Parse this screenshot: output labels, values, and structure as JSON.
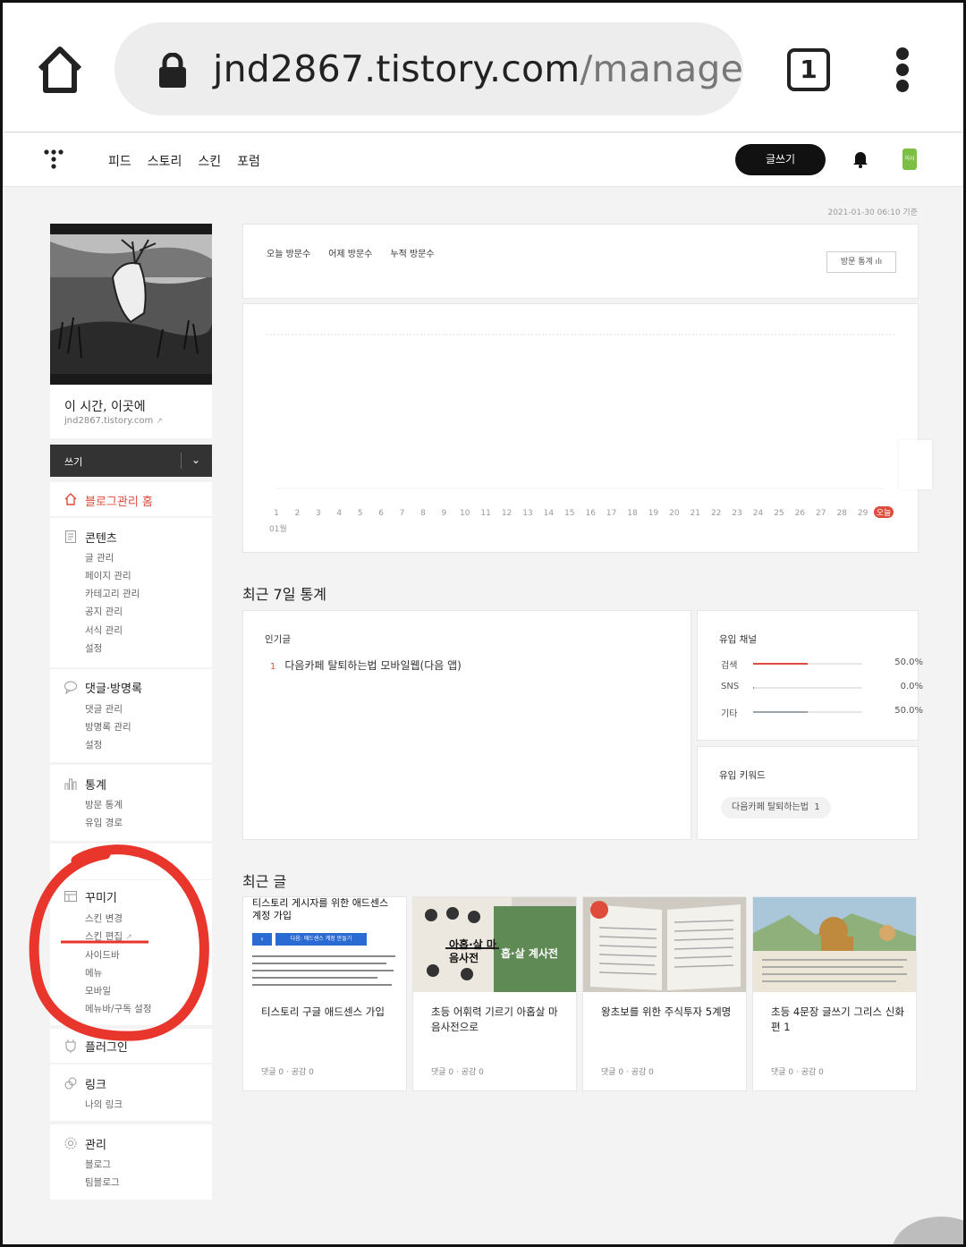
{
  "browser": {
    "url_host": "jnd2867.tistory.com",
    "url_path": "/manage",
    "tab_count": "1"
  },
  "topnav": {
    "links": [
      "피드",
      "스토리",
      "스킨",
      "포럼"
    ],
    "write_label": "글쓰기",
    "avatar_text": "이시간"
  },
  "timestamp": "2021-01-30 06:10 기준",
  "profile": {
    "blog_name": "이 시간, 이곳에",
    "blog_url": "jnd2867.tistory.com"
  },
  "write_bar": {
    "label": "쓰기"
  },
  "sidebar": {
    "home": "블로그관리 홈",
    "content": {
      "title": "콘텐츠",
      "items": [
        "글 관리",
        "페이지 관리",
        "카테고리 관리",
        "공지 관리",
        "서식 관리",
        "설정"
      ]
    },
    "comments": {
      "title": "댓글·방명록",
      "items": [
        "댓글 관리",
        "방명록 관리",
        "설정"
      ]
    },
    "stats": {
      "title": "통계",
      "items": [
        "방문 통계",
        "유입 경로"
      ]
    },
    "decorate": {
      "title": "꾸미기",
      "items": [
        "스킨 변경",
        "스킨 편집",
        "사이드바",
        "메뉴",
        "모바일",
        "메뉴바/구독 설정"
      ]
    },
    "plugin": {
      "title": "플러그인"
    },
    "link": {
      "title": "링크",
      "items": [
        "나의 링크"
      ]
    },
    "manage": {
      "title": "관리",
      "items": [
        "블로그",
        "팀블로그"
      ]
    }
  },
  "visits": {
    "today_label": "오늘 방문수",
    "yesterday_label": "어제 방문수",
    "total_label": "누적 방문수",
    "stats_button": "방문 통계"
  },
  "chart_data": {
    "type": "line",
    "x": [
      "1",
      "2",
      "3",
      "4",
      "5",
      "6",
      "7",
      "8",
      "9",
      "10",
      "11",
      "12",
      "13",
      "14",
      "15",
      "16",
      "17",
      "18",
      "19",
      "20",
      "21",
      "22",
      "23",
      "24",
      "25",
      "26",
      "27",
      "28",
      "29",
      "오늘"
    ],
    "xlabel": "01월",
    "today_label": "오늘",
    "series": [
      {
        "values": [
          0,
          0,
          0,
          0,
          0,
          0,
          0,
          0,
          0,
          0,
          0,
          0,
          0,
          0,
          0,
          0,
          0,
          0,
          0,
          0,
          0,
          0,
          0,
          0,
          0,
          0,
          0,
          0,
          0,
          0
        ]
      }
    ],
    "grid": true
  },
  "recent7": {
    "heading": "최근 7일 통계",
    "popular_title": "인기글",
    "popular": [
      {
        "rank": "1",
        "title": "다음카페 탈퇴하는법 모바일웹(다음 앱)"
      }
    ],
    "channels_title": "유입 채널",
    "channels": [
      {
        "name": "검색",
        "pct": "50.0%",
        "value": 0.5,
        "color": "#e04c3c"
      },
      {
        "name": "SNS",
        "pct": "0.0%",
        "value": 0.0,
        "color": "#4a9de0"
      },
      {
        "name": "기타",
        "pct": "50.0%",
        "value": 0.5,
        "color": "#9aa4ad"
      }
    ],
    "keywords_title": "유입 키워드",
    "keywords": [
      {
        "text": "다음카페 탈퇴하는법",
        "count": "1"
      }
    ]
  },
  "recent_posts": {
    "heading": "최근 글",
    "posts": [
      {
        "title": "티스토리 구글 애드센스 가입",
        "meta": "댓글 0 · 공감 0",
        "thumb_title": "티스토리 게시자를 위한 애드센스 계정 가입",
        "thumb_button": "다음: 애드센스 계정 만들기"
      },
      {
        "title": "초등 어휘력 기르기 아홉살 마음사전으로",
        "meta": "댓글 0 · 공감 0",
        "thumb_text_1": "아홉·살 마음사전",
        "thumb_text_2": "홉·살 계사전"
      },
      {
        "title": "왕초보를 위한 주식투자 5계명",
        "meta": "댓글 0 · 공감 0"
      },
      {
        "title": "초등 4문장 글쓰기 그리스 신화편 1",
        "meta": "댓글 0 · 공감 0"
      }
    ]
  },
  "colors": {
    "accent": "#e04c3c",
    "dark": "#111111",
    "annotation": "#e8362c"
  }
}
